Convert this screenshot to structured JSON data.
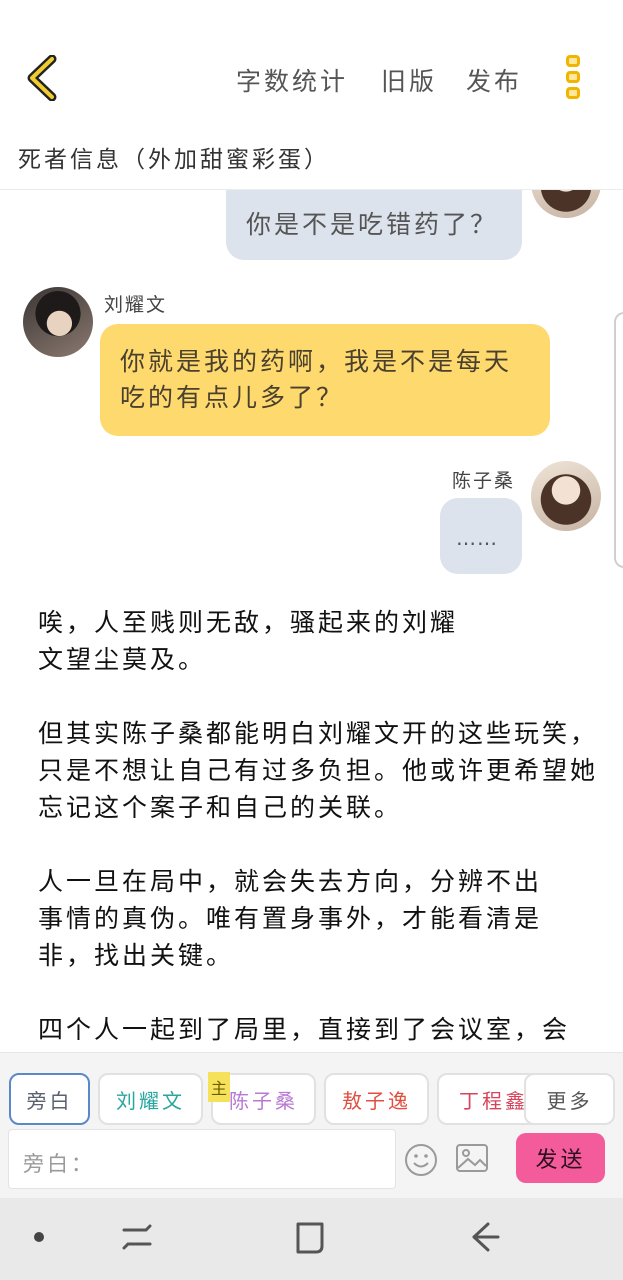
{
  "header": {
    "actions": {
      "word_count": "字数统计",
      "old_version": "旧版",
      "publish": "发布"
    },
    "doc_title": "死者信息（外加甜蜜彩蛋）"
  },
  "chat": [
    {
      "sender": "陈子桑",
      "side": "right",
      "text": "你是不是吃错药了？"
    },
    {
      "sender": "刘耀文",
      "side": "left",
      "text": "你就是我的药啊，我是不是每天吃的有点儿多了？"
    },
    {
      "sender": "陈子桑",
      "side": "right",
      "text": "……"
    }
  ],
  "story": [
    "唉，人至贱则无敌，骚起来的刘耀文望尘莫及。",
    "但其实陈子桑都能明白刘耀文开的这些玩笑，只是不想让自己有过多负担。他或许更希望她忘记这个案子和自己的关联。",
    "人一旦在局中，就会失去方向，分辨不出事情的真伪。唯有置身事外，才能看清是非，找出关键。",
    "四个人一起到了局里，直接到了会议室，会"
  ],
  "roles": {
    "items": [
      {
        "label": "旁白",
        "color": "#5a6270",
        "selected": true
      },
      {
        "label": "刘耀文",
        "color": "#27a6a0"
      },
      {
        "label": "陈子桑",
        "color": "#b779d4"
      },
      {
        "label": "敖子逸",
        "color": "#e04f3f"
      },
      {
        "label": "丁程鑫",
        "color": "#d6455c"
      }
    ],
    "more": "更多",
    "owner_badge": "主"
  },
  "input": {
    "placeholder": "旁白："
  },
  "send_label": "发送",
  "colors": {
    "accent_yellow": "#fed96d",
    "bubble_gray": "#dde3ec",
    "send_pink": "#f45b9a"
  }
}
